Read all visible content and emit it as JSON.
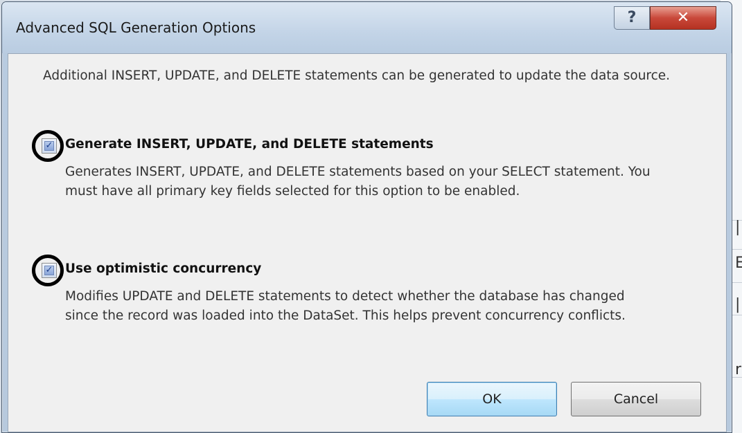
{
  "window": {
    "title": "Advanced SQL Generation Options",
    "help_glyph": "?",
    "close_glyph": "✕"
  },
  "intro_text": "Additional INSERT, UPDATE, and DELETE statements can be generated to update the data source.",
  "options": [
    {
      "label": "Generate INSERT, UPDATE, and DELETE statements",
      "checked": true,
      "description": "Generates INSERT, UPDATE, and DELETE statements based on your SELECT statement. You must have all primary key fields selected for this option to be enabled."
    },
    {
      "label": "Use optimistic concurrency",
      "checked": true,
      "description": "Modifies UPDATE and DELETE statements to detect whether the database has changed since the record was loaded into the DataSet. This helps prevent concurrency conflicts."
    }
  ],
  "checkmark_glyph": "✓",
  "buttons": {
    "ok": "OK",
    "cancel": "Cancel"
  },
  "background_glyphs": [
    "|",
    "E",
    "|",
    "r"
  ],
  "colors": {
    "close_button": "#c9483a",
    "default_button": "#bee6fd",
    "annotation_circle": "#000000"
  }
}
